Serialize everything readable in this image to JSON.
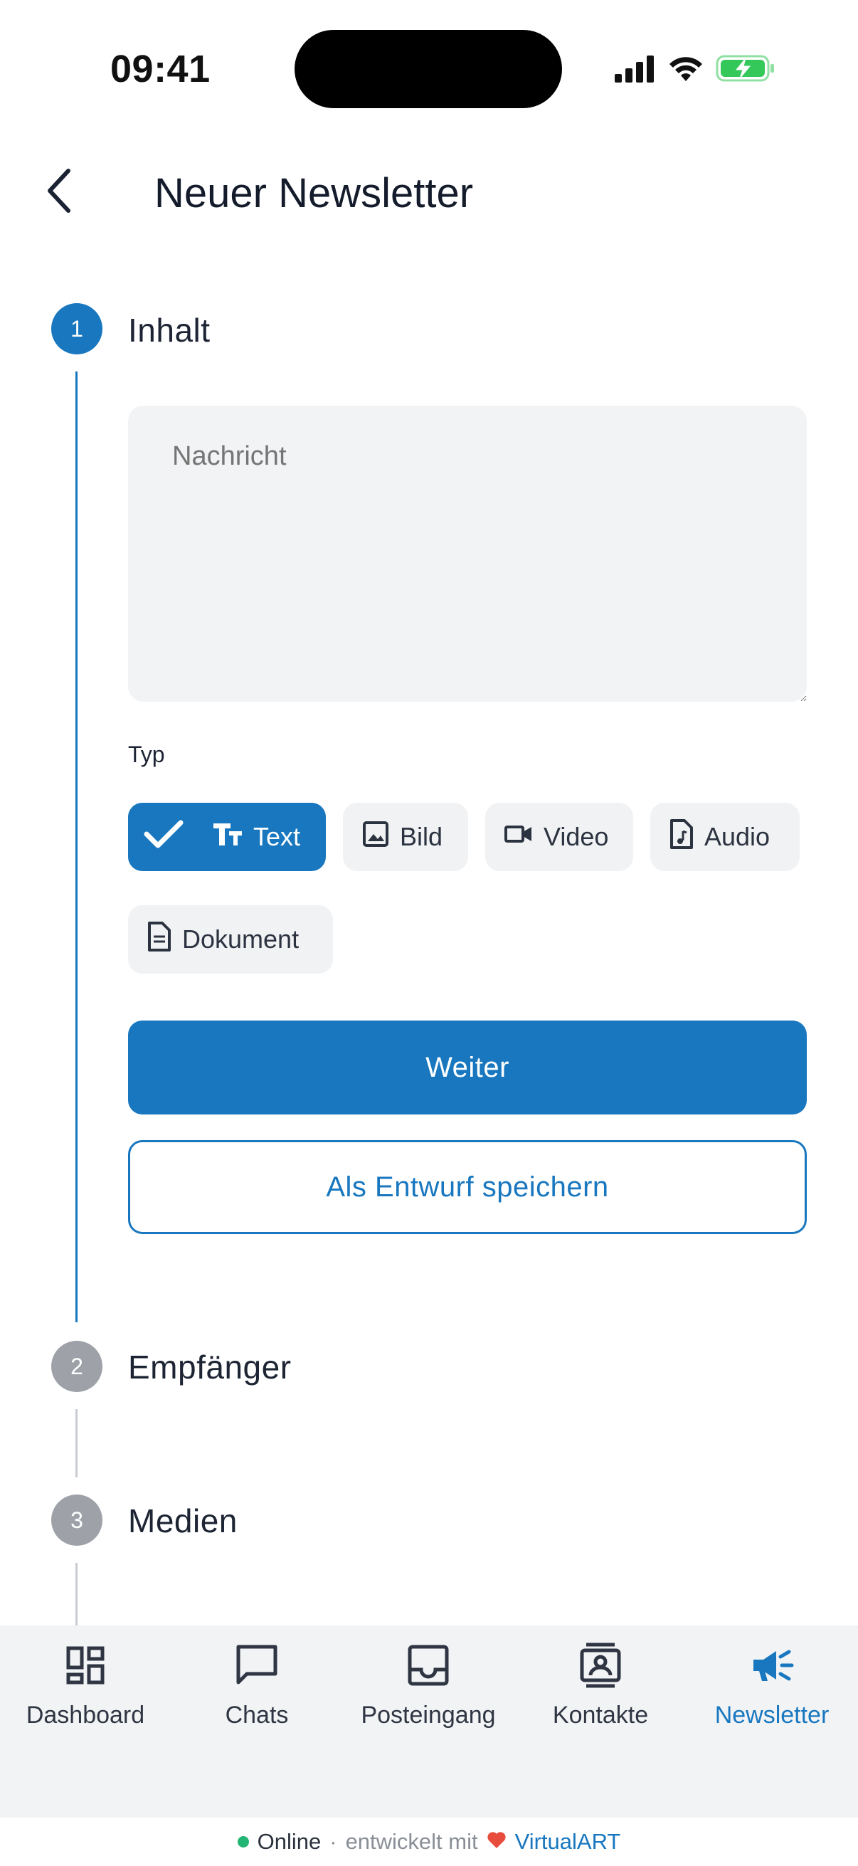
{
  "status_bar": {
    "time": "09:41"
  },
  "header": {
    "title": "Neuer Newsletter",
    "back_icon": "chevron-left-icon"
  },
  "steps": [
    {
      "number": "1",
      "label": "Inhalt",
      "state": "active"
    },
    {
      "number": "2",
      "label": "Empfänger",
      "state": "inactive"
    },
    {
      "number": "3",
      "label": "Medien",
      "state": "inactive"
    }
  ],
  "content": {
    "message_placeholder": "Nachricht",
    "message_value": "",
    "type_label": "Typ",
    "types": [
      {
        "label": "Text",
        "icon": "text-format-icon",
        "selected": true
      },
      {
        "label": "Bild",
        "icon": "image-icon",
        "selected": false
      },
      {
        "label": "Video",
        "icon": "video-icon",
        "selected": false
      },
      {
        "label": "Audio",
        "icon": "audio-file-icon",
        "selected": false
      },
      {
        "label": "Dokument",
        "icon": "document-icon",
        "selected": false
      }
    ],
    "next_button": "Weiter",
    "draft_button": "Als Entwurf speichern"
  },
  "bottom_nav": [
    {
      "label": "Dashboard",
      "icon": "dashboard-icon",
      "active": false
    },
    {
      "label": "Chats",
      "icon": "chat-icon",
      "active": false
    },
    {
      "label": "Posteingang",
      "icon": "inbox-icon",
      "active": false
    },
    {
      "label": "Kontakte",
      "icon": "contacts-icon",
      "active": false
    },
    {
      "label": "Newsletter",
      "icon": "megaphone-icon",
      "active": true
    }
  ],
  "footer": {
    "status": "Online",
    "separator": "·",
    "developed_with": "entwickelt mit",
    "brand": "VirtualART"
  },
  "colors": {
    "accent": "#1877bf",
    "inactive_step": "#9ea2a8",
    "online": "#22b573",
    "heart": "#e74c3c"
  }
}
